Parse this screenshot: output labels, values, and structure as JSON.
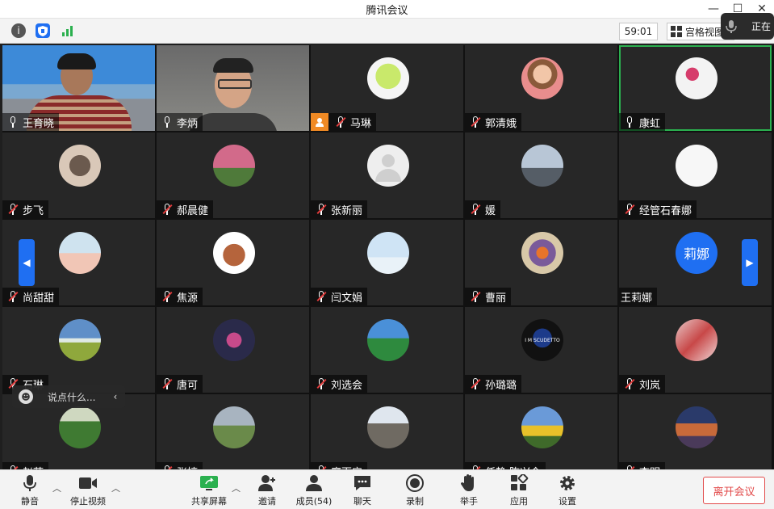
{
  "window": {
    "title": "腾讯会议",
    "min": "—",
    "max": "☐",
    "close": "✕"
  },
  "toolbar": {
    "timer": "59:01",
    "grid_view_label": "宫格视图",
    "speaking_label": "正在"
  },
  "participants": [
    {
      "name": "王育晓",
      "muted": false,
      "avatar": "video-man-scenery",
      "active": false
    },
    {
      "name": "李炳",
      "muted": false,
      "avatar": "video-man-glasses",
      "active": false
    },
    {
      "name": "马琳",
      "muted": true,
      "avatar": "cartoon-green-bear",
      "active": false,
      "badge": "host-icon"
    },
    {
      "name": "郭清娥",
      "muted": true,
      "avatar": "illustrated-woman",
      "active": false
    },
    {
      "name": "康虹",
      "muted": false,
      "avatar": "pink-flowers",
      "active": true
    },
    {
      "name": "步飞",
      "muted": true,
      "avatar": "cat",
      "active": false
    },
    {
      "name": "郝晨健",
      "muted": true,
      "avatar": "blossom-tree",
      "active": false
    },
    {
      "name": "张新丽",
      "muted": true,
      "avatar": "default-avatar",
      "active": false
    },
    {
      "name": "媛",
      "muted": true,
      "avatar": "tower-bridge",
      "active": false
    },
    {
      "name": "经管石春娜",
      "muted": true,
      "avatar": "sketch-figure",
      "active": false
    },
    {
      "name": "尚甜甜",
      "muted": true,
      "avatar": "baby",
      "active": false
    },
    {
      "name": "焦源",
      "muted": true,
      "avatar": "toy-horse",
      "active": false
    },
    {
      "name": "闫文娟",
      "muted": true,
      "avatar": "cartoon-bear",
      "active": false
    },
    {
      "name": "曹丽",
      "muted": true,
      "avatar": "flowers-book",
      "active": false
    },
    {
      "name": "王莉娜",
      "muted": false,
      "avatar": "text-avatar",
      "avatar_text": "莉娜",
      "active": false,
      "no_mic": true
    },
    {
      "name": "石琳",
      "muted": true,
      "avatar": "meadow-sky",
      "active": false
    },
    {
      "name": "唐可",
      "muted": true,
      "avatar": "anime-group",
      "active": false
    },
    {
      "name": "刘选会",
      "muted": true,
      "avatar": "green-lake",
      "active": false
    },
    {
      "name": "孙璐璐",
      "muted": true,
      "avatar": "scudetto-logo",
      "avatar_text": "I M SCUDETTO",
      "active": false
    },
    {
      "name": "刘岚",
      "muted": true,
      "avatar": "abstract-collage",
      "active": false
    },
    {
      "name": "赵萍",
      "muted": true,
      "avatar": "green-plants",
      "active": false
    },
    {
      "name": "张婷",
      "muted": true,
      "avatar": "woman-garden",
      "active": false
    },
    {
      "name": "廖百宁",
      "muted": true,
      "avatar": "mountains",
      "active": false
    },
    {
      "name": "任静 陈兴会",
      "muted": true,
      "avatar": "sunflowers",
      "active": false
    },
    {
      "name": "李明",
      "muted": true,
      "avatar": "temple-night",
      "active": false
    }
  ],
  "chat": {
    "placeholder": "说点什么..."
  },
  "bottom": {
    "mute": "静音",
    "stop_video": "停止视频",
    "share": "共享屏幕",
    "invite": "邀请",
    "members": "成员(54)",
    "chat": "聊天",
    "record": "录制",
    "raise_hand": "举手",
    "apps": "应用",
    "settings": "设置",
    "leave": "离开会议"
  },
  "colors": {
    "accent": "#1f6ff2",
    "active_border": "#2bb04f",
    "leave": "#e24a4a"
  }
}
